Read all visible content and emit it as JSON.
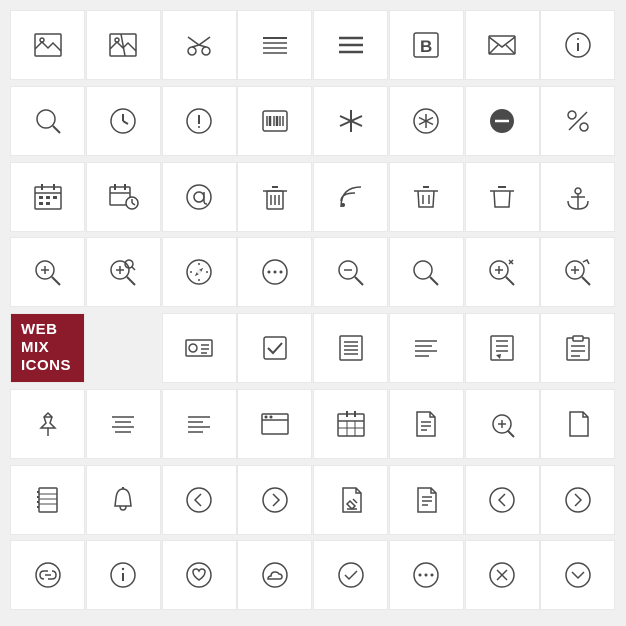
{
  "title": "WEB Mix ICONS",
  "label_line1": "WEB MIX",
  "label_line2": "ICONS",
  "accent_color": "#8b1a2a",
  "icons": [
    {
      "name": "image-icon",
      "desc": "image with mountains"
    },
    {
      "name": "image-broken-icon",
      "desc": "broken image"
    },
    {
      "name": "scissors-icon",
      "desc": "scissors"
    },
    {
      "name": "list-icon",
      "desc": "list lines"
    },
    {
      "name": "menu-icon",
      "desc": "hamburger menu"
    },
    {
      "name": "bold-icon",
      "desc": "bold B"
    },
    {
      "name": "email-icon",
      "desc": "email envelope"
    },
    {
      "name": "info-circle-icon",
      "desc": "info circle"
    },
    {
      "name": "search-icon",
      "desc": "search magnifier"
    },
    {
      "name": "clock-icon",
      "desc": "clock"
    },
    {
      "name": "warning-circle-icon",
      "desc": "warning circle"
    },
    {
      "name": "barcode-icon",
      "desc": "barcode"
    },
    {
      "name": "asterisk-icon",
      "desc": "asterisk"
    },
    {
      "name": "asterisk-circle-icon",
      "desc": "asterisk in circle"
    },
    {
      "name": "minus-circle-icon",
      "desc": "minus circle filled"
    },
    {
      "name": "percent-icon",
      "desc": "percent"
    },
    {
      "name": "calendar-icon",
      "desc": "calendar"
    },
    {
      "name": "calendar-clock-icon",
      "desc": "calendar with clock"
    },
    {
      "name": "at-sign-icon",
      "desc": "at symbol"
    },
    {
      "name": "trash-icon",
      "desc": "trash"
    },
    {
      "name": "rss-icon",
      "desc": "rss feed"
    },
    {
      "name": "trash2-icon",
      "desc": "trash alt"
    },
    {
      "name": "trash3-icon",
      "desc": "trash outline"
    },
    {
      "name": "anchor-icon",
      "desc": "anchor"
    },
    {
      "name": "zoom-in-icon",
      "desc": "zoom in"
    },
    {
      "name": "zoom-search-icon",
      "desc": "zoom search"
    },
    {
      "name": "compass-icon",
      "desc": "compass"
    },
    {
      "name": "dots-icon",
      "desc": "three dots"
    },
    {
      "name": "zoom-out-icon",
      "desc": "zoom out"
    },
    {
      "name": "search2-icon",
      "desc": "search"
    },
    {
      "name": "zoom-in2-icon",
      "desc": "zoom in alt"
    },
    {
      "name": "zoom-up-icon",
      "desc": "zoom up"
    },
    {
      "name": "contact-card-icon",
      "desc": "contact card"
    },
    {
      "name": "checkbox-icon",
      "desc": "checkbox check"
    },
    {
      "name": "checklist-icon",
      "desc": "checklist"
    },
    {
      "name": "text-left-icon",
      "desc": "text align left"
    },
    {
      "name": "notepad-icon",
      "desc": "notepad"
    },
    {
      "name": "clipboard-icon",
      "desc": "clipboard"
    },
    {
      "name": "pin-icon",
      "desc": "pin"
    },
    {
      "name": "lines-center-icon",
      "desc": "lines center"
    },
    {
      "name": "lines-left-icon",
      "desc": "lines left"
    },
    {
      "name": "window-icon",
      "desc": "window"
    },
    {
      "name": "calendar2-icon",
      "desc": "calendar grid"
    },
    {
      "name": "document-lines-icon",
      "desc": "document with lines"
    },
    {
      "name": "magnifier-doc-icon",
      "desc": "magnifier document"
    },
    {
      "name": "document-blank-icon",
      "desc": "blank document"
    },
    {
      "name": "notebook-icon",
      "desc": "notebook"
    },
    {
      "name": "bell-icon",
      "desc": "bell"
    },
    {
      "name": "arrow-left-circle-icon",
      "desc": "arrow left circle"
    },
    {
      "name": "arrow-right-circle-icon",
      "desc": "arrow right circle"
    },
    {
      "name": "edit-doc-icon",
      "desc": "edit document"
    },
    {
      "name": "pen-doc-icon",
      "desc": "pen document"
    },
    {
      "name": "chevron-left-circle-icon",
      "desc": "chevron left circle"
    },
    {
      "name": "chevron-right-circle-icon",
      "desc": "chevron right circle"
    },
    {
      "name": "link-icon",
      "desc": "link"
    },
    {
      "name": "info-circle2-icon",
      "desc": "info circle"
    },
    {
      "name": "heart-circle-icon",
      "desc": "heart circle"
    },
    {
      "name": "cloud-circle-icon",
      "desc": "cloud circle"
    },
    {
      "name": "check-circle-icon",
      "desc": "check circle"
    },
    {
      "name": "dots-circle-icon",
      "desc": "dots circle"
    },
    {
      "name": "x-circle-icon",
      "desc": "x circle"
    },
    {
      "name": "chevron-down-circle-icon",
      "desc": "chevron down circle"
    }
  ]
}
